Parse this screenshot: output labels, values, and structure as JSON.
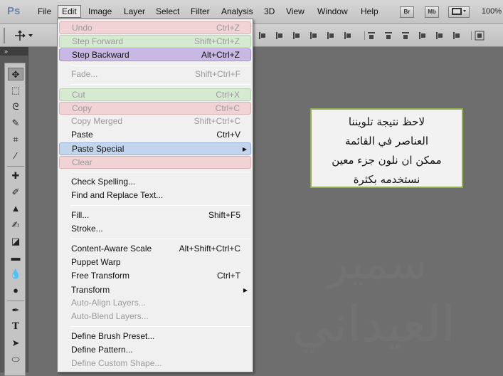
{
  "app": {
    "logo": "Ps",
    "zoom": "100%"
  },
  "menubar": {
    "items": [
      "File",
      "Edit",
      "Image",
      "Layer",
      "Select",
      "Filter",
      "Analysis",
      "3D",
      "View",
      "Window",
      "Help"
    ],
    "active": "Edit",
    "buttons": [
      "Br",
      "Mb"
    ]
  },
  "edit_menu": {
    "items": [
      {
        "label": "Undo",
        "shortcut": "Ctrl+Z"
      },
      {
        "label": "Step Forward",
        "shortcut": "Shift+Ctrl+Z"
      },
      {
        "label": "Step Backward",
        "shortcut": "Alt+Ctrl+Z"
      },
      {
        "label": "Fade...",
        "shortcut": "Shift+Ctrl+F"
      },
      {
        "label": "Cut",
        "shortcut": "Ctrl+X"
      },
      {
        "label": "Copy",
        "shortcut": "Ctrl+C"
      },
      {
        "label": "Copy Merged",
        "shortcut": "Shift+Ctrl+C"
      },
      {
        "label": "Paste",
        "shortcut": "Ctrl+V"
      },
      {
        "label": "Paste Special",
        "shortcut": ""
      },
      {
        "label": "Clear",
        "shortcut": ""
      },
      {
        "label": "Check Spelling...",
        "shortcut": ""
      },
      {
        "label": "Find and Replace Text...",
        "shortcut": ""
      },
      {
        "label": "Fill...",
        "shortcut": "Shift+F5"
      },
      {
        "label": "Stroke...",
        "shortcut": ""
      },
      {
        "label": "Content-Aware Scale",
        "shortcut": "Alt+Shift+Ctrl+C"
      },
      {
        "label": "Puppet Warp",
        "shortcut": ""
      },
      {
        "label": "Free Transform",
        "shortcut": "Ctrl+T"
      },
      {
        "label": "Transform",
        "shortcut": ""
      },
      {
        "label": "Auto-Align Layers...",
        "shortcut": ""
      },
      {
        "label": "Auto-Blend Layers...",
        "shortcut": ""
      },
      {
        "label": "Define Brush Preset...",
        "shortcut": ""
      },
      {
        "label": "Define Pattern...",
        "shortcut": ""
      },
      {
        "label": "Define Custom Shape...",
        "shortcut": ""
      }
    ],
    "highlight_colors": {
      "red": "#f1d3d6",
      "green": "#d6ead2",
      "purple": "#c9b8e3",
      "blue": "#c3d5ec"
    }
  },
  "note": {
    "lines": [
      "لاحظ نتيجة تلويننا",
      "العناصر في القائمة",
      "ممكن ان نلون جزء معين",
      "نستخدمه بكثرة"
    ],
    "border_color": "#8fb04a"
  },
  "watermark": {
    "line1": "سمير",
    "line2": "العيداني"
  }
}
